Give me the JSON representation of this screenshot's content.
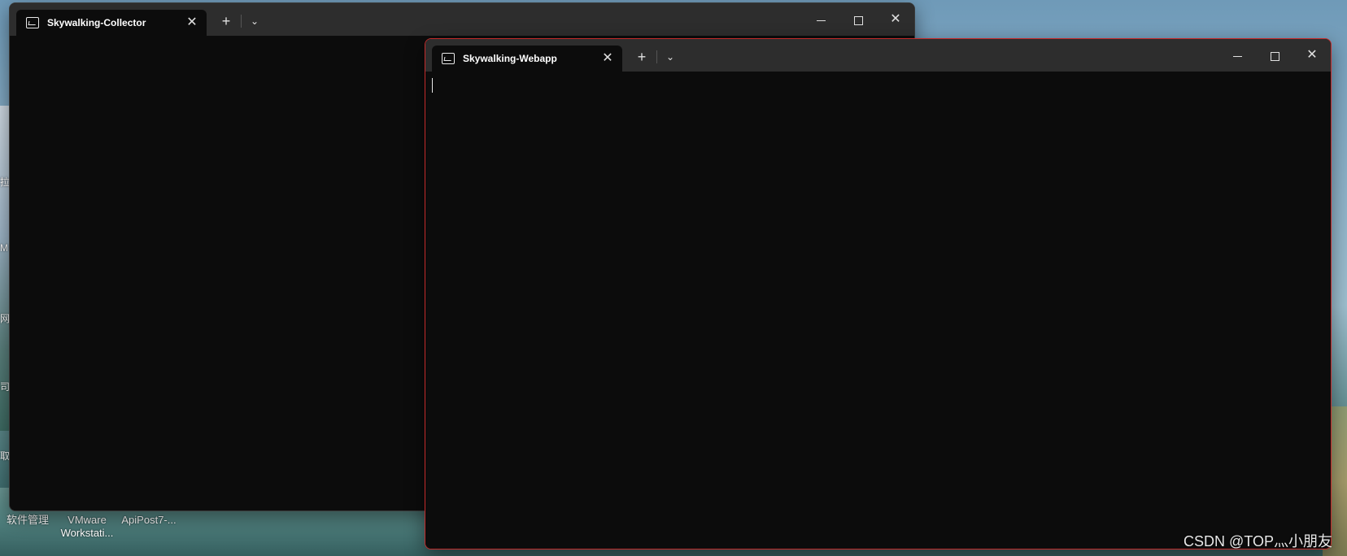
{
  "desktop": {
    "icons": [
      {
        "label": "软件管理"
      },
      {
        "label": "VMware Workstati..."
      },
      {
        "label": "ApiPost7-..."
      }
    ],
    "edge_chars": [
      "拉",
      "M",
      "网",
      "司",
      "取"
    ]
  },
  "windows": [
    {
      "tab_title": "Skywalking-Collector",
      "tab_close": "✕",
      "new_tab": "+",
      "dropdown": "⌄",
      "close": "✕"
    },
    {
      "tab_title": "Skywalking-Webapp",
      "tab_close": "✕",
      "new_tab": "+",
      "dropdown": "⌄",
      "close": "✕"
    }
  ],
  "watermark": "CSDN @TOP灬小朋友",
  "colors": {
    "terminal_bg": "#0c0c0c",
    "titlebar_bg": "#2d2d2d",
    "active_border": "#c42b2b"
  }
}
